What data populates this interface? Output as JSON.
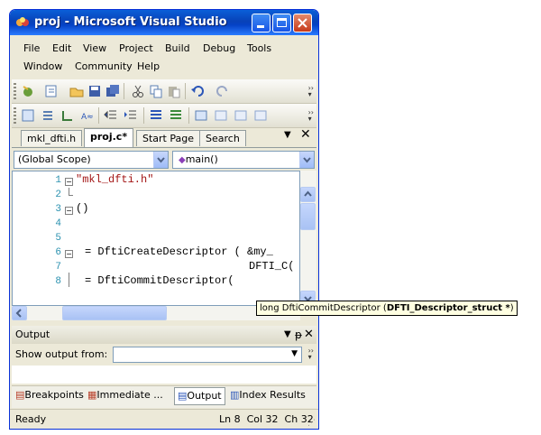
{
  "window": {
    "title": "proj - Microsoft Visual Studio"
  },
  "menu": [
    [
      "File",
      "Edit",
      "View",
      "Project",
      "Build",
      "Debug",
      "Tools"
    ],
    [
      "Window",
      "Community",
      "Help"
    ]
  ],
  "tabs": {
    "items": [
      "mkl_dfti.h",
      "proj.c*",
      "Start Page",
      "Search"
    ],
    "active": "proj.c*"
  },
  "scope_combo": {
    "left": "(Global Scope)",
    "right": "main()"
  },
  "editor": {
    "lines": [
      {
        "num": "1",
        "text": "\"mkl_dfti.h\""
      },
      {
        "num": "2",
        "text": ""
      },
      {
        "num": "3",
        "text": "()"
      },
      {
        "num": "4",
        "text": ""
      },
      {
        "num": "5",
        "text": ""
      },
      {
        "num": "6",
        "text": "= DftiCreateDescriptor ( &my_"
      },
      {
        "num": "7",
        "text": "DFTI_C("
      },
      {
        "num": "8",
        "text": "= DftiCommitDescriptor("
      }
    ]
  },
  "tooltip": {
    "prefix": "long DftiCommitDescriptor (",
    "bold": "DFTI_Descriptor_struct *",
    "suffix": ")"
  },
  "output": {
    "title": "Output",
    "show_label": "Show output from:"
  },
  "bottom_tabs": [
    "Breakpoints",
    "Immediate ...",
    "Output",
    "Index Results"
  ],
  "status": {
    "left": "Ready",
    "right": "Ln 8  Col 32  Ch 32"
  }
}
